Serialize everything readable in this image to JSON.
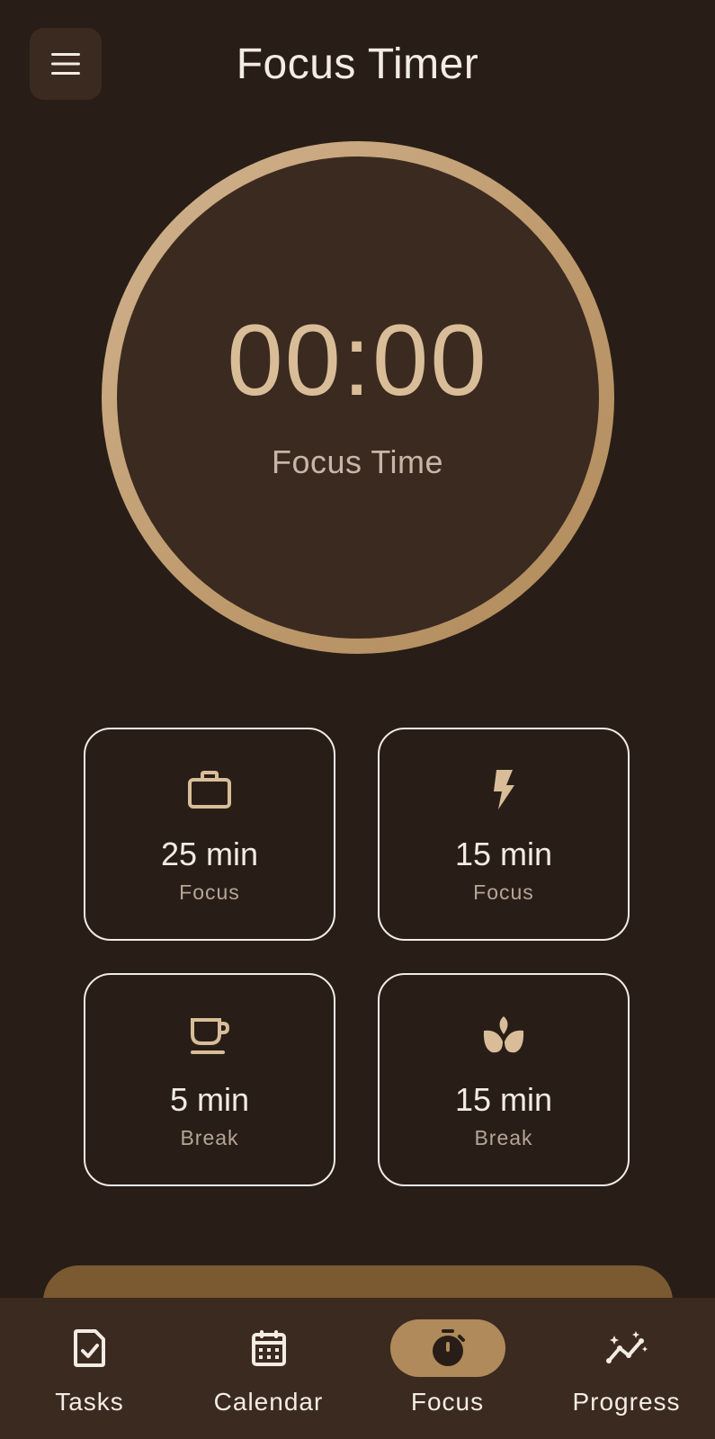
{
  "header": {
    "title": "Focus Timer",
    "menu_icon": "menu-icon"
  },
  "timer": {
    "time": "00:00",
    "mode": "Focus Time"
  },
  "presets": [
    {
      "icon": "briefcase-icon",
      "value": "25 min",
      "kind": "Focus"
    },
    {
      "icon": "bolt-icon",
      "value": "15 min",
      "kind": "Focus"
    },
    {
      "icon": "coffee-cup-icon",
      "value": "5 min",
      "kind": "Break"
    },
    {
      "icon": "lotus-icon",
      "value": "15 min",
      "kind": "Break"
    }
  ],
  "nav": {
    "items": [
      {
        "label": "Tasks",
        "icon": "task-doc-icon"
      },
      {
        "label": "Calendar",
        "icon": "calendar-icon"
      },
      {
        "label": "Focus",
        "icon": "stopwatch-icon",
        "active": true
      },
      {
        "label": "Progress",
        "icon": "progress-chart-icon"
      }
    ]
  },
  "colors": {
    "background": "#281e17",
    "surface": "#3b2a20",
    "accent": "#b08a5a",
    "accent_light": "#d2b490",
    "text": "#f3ece4",
    "muted_text": "#b6a596",
    "start_button": "#7b5a32"
  }
}
